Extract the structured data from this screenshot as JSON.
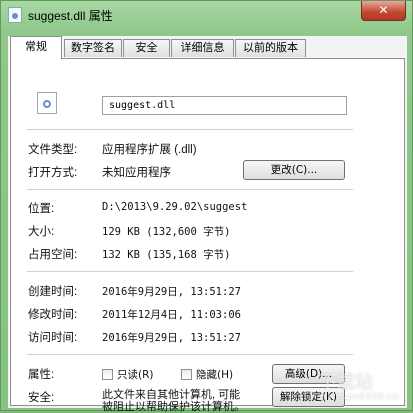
{
  "window": {
    "title": "suggest.dll 属性",
    "close_label": "✕"
  },
  "tabs": [
    {
      "label": "常规"
    },
    {
      "label": "数字签名"
    },
    {
      "label": "安全"
    },
    {
      "label": "详细信息"
    },
    {
      "label": "以前的版本"
    }
  ],
  "general": {
    "filename": "suggest.dll",
    "file_type": {
      "label": "文件类型:",
      "value": "应用程序扩展 (.dll)"
    },
    "open_with": {
      "label": "打开方式:",
      "value": "未知应用程序",
      "button": "更改(C)..."
    },
    "location": {
      "label": "位置:",
      "value": "D:\\2013\\9.29.02\\suggest"
    },
    "size": {
      "label": "大小:",
      "value": "129 KB (132,600 字节)"
    },
    "size_on_disk": {
      "label": "占用空间:",
      "value": "132 KB (135,168 字节)"
    },
    "created": {
      "label": "创建时间:",
      "value": "2016年9月29日, 13:51:27"
    },
    "modified": {
      "label": "修改时间:",
      "value": "2011年12月4日, 11:03:06"
    },
    "accessed": {
      "label": "访问时间:",
      "value": "2016年9月29日, 13:51:27"
    },
    "attributes": {
      "label": "属性:",
      "readonly": "只读(R)",
      "hidden": "隐藏(H)",
      "advanced_button": "高级(D)..."
    },
    "security": {
      "label": "安全:",
      "line1": "此文件来自其他计算机, 可能",
      "line2": "被阻止以帮助保护该计算机。",
      "unblock_button": "解除锁定(K)"
    }
  },
  "watermark": {
    "main": "下载站",
    "sub": "www.pc0359.cn"
  }
}
